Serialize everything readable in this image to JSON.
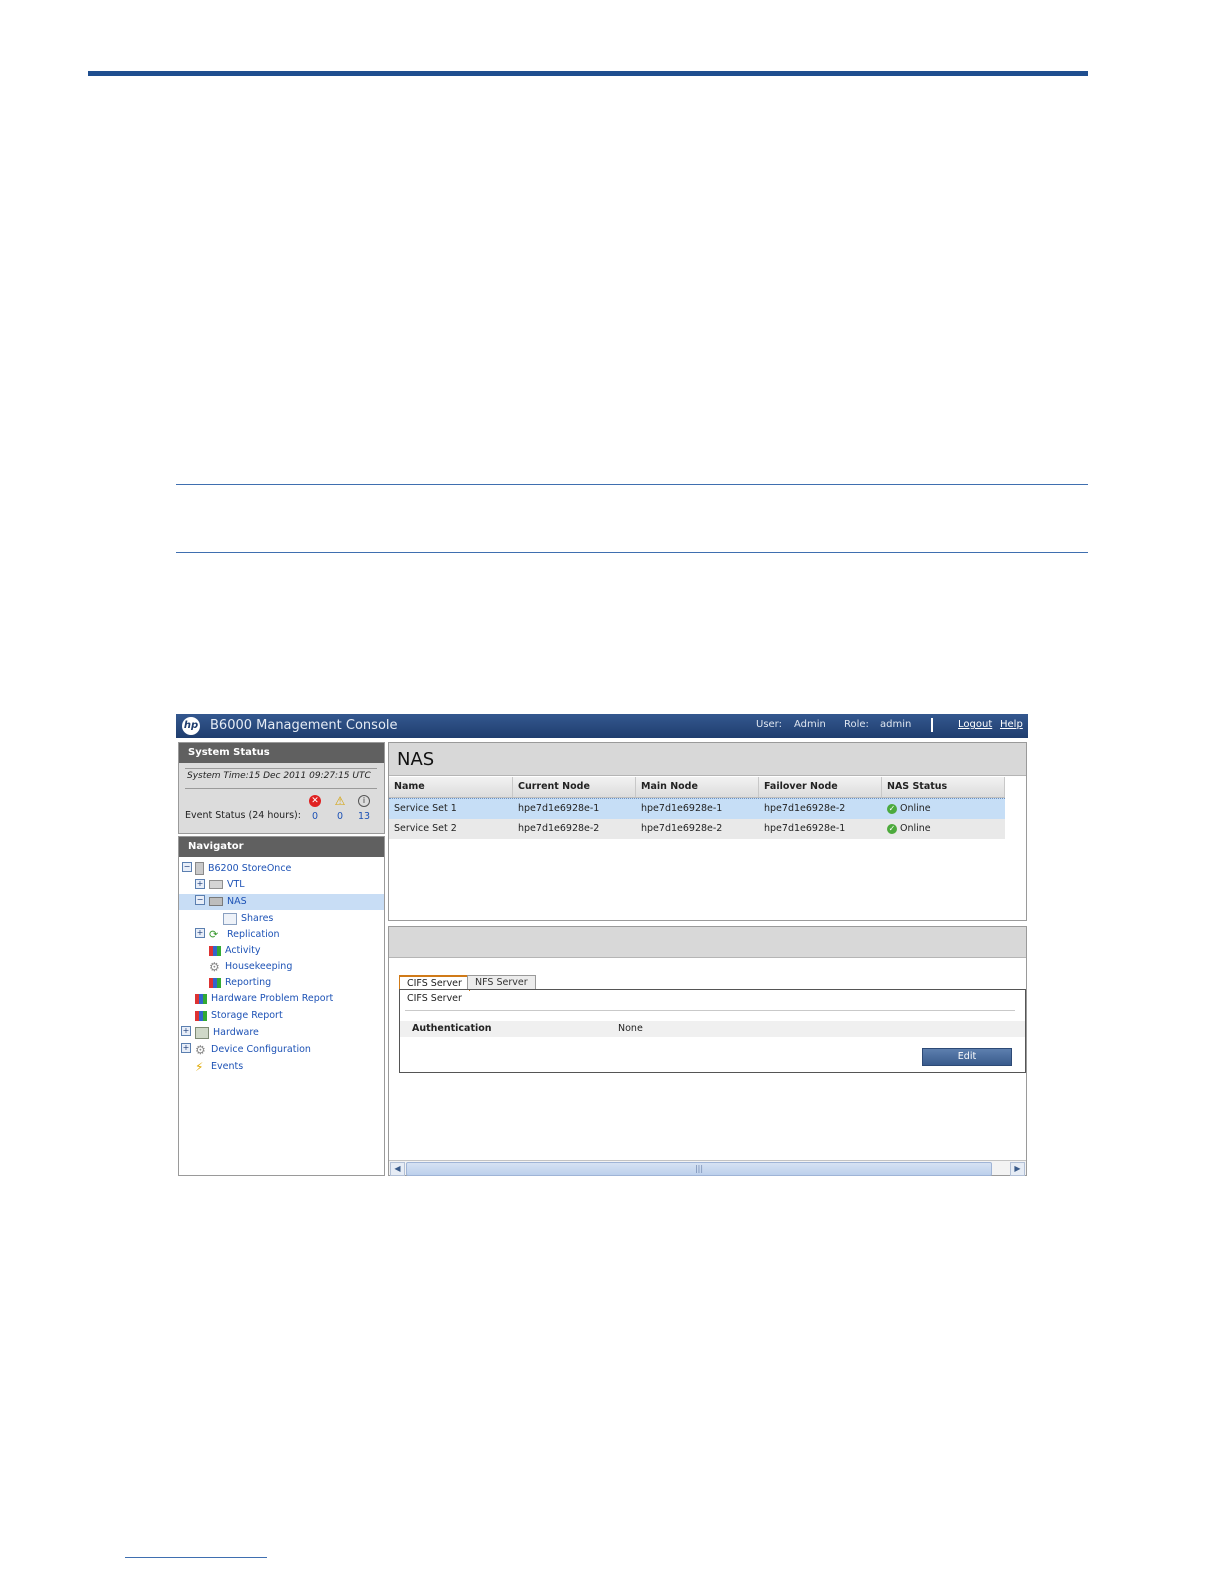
{
  "header": {
    "title": "B6000 Management Console",
    "user_label": "User:",
    "user_value": "Admin",
    "role_label": "Role:",
    "role_value": "admin",
    "logout": "Logout",
    "help": "Help",
    "logo_text": "hp"
  },
  "system_status": {
    "title": "System Status",
    "time": "System Time:15 Dec 2011 09:27:15 UTC",
    "event_label": "Event Status (24 hours):",
    "errors": "0",
    "warnings": "0",
    "info": "13"
  },
  "navigator": {
    "title": "Navigator",
    "items": [
      {
        "label": "B6200 StoreOnce",
        "icon": "server-icon"
      },
      {
        "label": "VTL",
        "icon": "tape-library-icon"
      },
      {
        "label": "NAS",
        "icon": "nas-icon"
      },
      {
        "label": "Shares",
        "icon": "shares-icon"
      },
      {
        "label": "Replication",
        "icon": "replication-icon"
      },
      {
        "label": "Activity",
        "icon": "bar-chart-icon"
      },
      {
        "label": "Housekeeping",
        "icon": "gear-icon"
      },
      {
        "label": "Reporting",
        "icon": "bar-chart-icon"
      },
      {
        "label": "Hardware Problem Report",
        "icon": "bar-chart-icon"
      },
      {
        "label": "Storage Report",
        "icon": "bar-chart-icon"
      },
      {
        "label": "Hardware",
        "icon": "hardware-icon"
      },
      {
        "label": "Device Configuration",
        "icon": "gear-icon"
      },
      {
        "label": "Events",
        "icon": "lightning-icon"
      }
    ]
  },
  "nas": {
    "title": "NAS",
    "columns": [
      "Name",
      "Current Node",
      "Main Node",
      "Failover Node",
      "NAS Status"
    ],
    "rows": [
      {
        "name": "Service Set 1",
        "current": "hpe7d1e6928e-1",
        "main": "hpe7d1e6928e-1",
        "failover": "hpe7d1e6928e-2",
        "status": "Online"
      },
      {
        "name": "Service Set 2",
        "current": "hpe7d1e6928e-2",
        "main": "hpe7d1e6928e-2",
        "failover": "hpe7d1e6928e-1",
        "status": "Online"
      }
    ]
  },
  "detail": {
    "tabs": [
      "CIFS Server",
      "NFS Server"
    ],
    "section_label": "CIFS Server",
    "auth_label": "Authentication",
    "auth_value": "None",
    "edit": "Edit"
  },
  "colors": {
    "accent": "#1f4e8f",
    "header": "#1f3d6e",
    "selection": "#c6def6",
    "online": "#4caa3d"
  }
}
